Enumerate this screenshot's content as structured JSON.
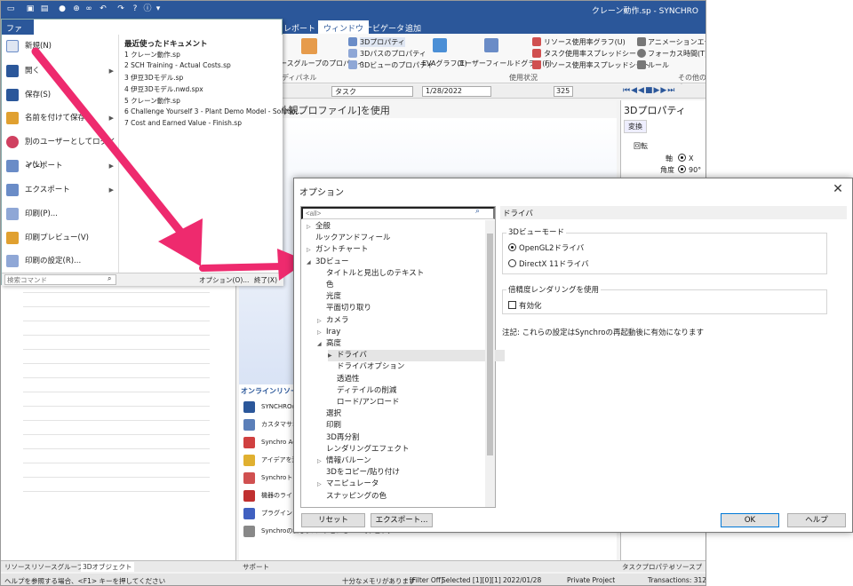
{
  "app": {
    "window_title": "クレーン動作.sp - SYNCHRO"
  },
  "menubar": {
    "file": "ファイル",
    "tabs": [
      "レポート",
      "ウィンドウ",
      "ナビゲータ",
      "追加"
    ]
  },
  "ribbon": {
    "resource_group_props": "ースグループのプロパティ",
    "items3d": [
      "3Dプロパティ",
      "3Dパスのプロパティ",
      "3Dビューのプロパティ"
    ],
    "evagraph": "EVAグラフ(E)",
    "user_field_graph": "ユーザーフィールドグラフ(F)",
    "usage": [
      "リソース使用率グラフ(U)",
      "タスク使用率スプレッドシート",
      "リソース使用率スプレッドシート"
    ],
    "misc": [
      "アニメーションエディタ",
      "フォーカス時間(T)",
      "ルール"
    ],
    "group_labels": [
      "ディパネル",
      "使用状況",
      "その他のウ"
    ]
  },
  "toolbar": {
    "task": "タスク",
    "date": "1/28/2022",
    "zoom": "325"
  },
  "file_menu": {
    "items": [
      {
        "label": "新規(N)",
        "arrow": false
      },
      {
        "label": "開く",
        "arrow": true
      },
      {
        "label": "保存(S)",
        "arrow": false
      },
      {
        "label": "名前を付けて保存",
        "arrow": true
      },
      {
        "label": "別のユーザーとしてログイン(L)",
        "arrow": false
      },
      {
        "label": "インポート",
        "arrow": true
      },
      {
        "label": "エクスポート",
        "arrow": true
      },
      {
        "label": "印刷(P)...",
        "arrow": false
      },
      {
        "label": "印刷プレビュー(V)",
        "arrow": false
      },
      {
        "label": "印刷の設定(R)...",
        "arrow": false
      }
    ],
    "recent_title": "最近使ったドキュメント",
    "recent": [
      "1 クレーン動作.sp",
      "2 SCH Training - Actual Costs.sp",
      "3 伊豆3Dモデル.sp",
      "4 伊豆3Dモデル.nwd.spx",
      "5 クレーン動作.sp",
      "6 Challenge Yourself 3 - Plant Demo Model - Solutio...",
      "7 Cost and Earned Value - Finish.sp"
    ],
    "search_placeholder": "検索コマンド",
    "options_button": "オプション(O)...",
    "exit_button": "終了(X)"
  },
  "view": {
    "header": "最高]色[外観プロファイル]を使用"
  },
  "right_panel": {
    "title": "3Dプロパティ",
    "tab": "変換",
    "rotation": "回転",
    "axis": "軸",
    "axis_x": "X",
    "angle": "角度",
    "angle_val": "90°"
  },
  "online": {
    "title": "オンラインリソース",
    "items": [
      "SYNCHROの",
      "カスタマサポ",
      "Synchro Ac",
      "アイデアを送",
      "Synchroトレ",
      "機器のライ",
      "プラグインと",
      "Synchroの新しいバージョンをWebでチェック"
    ]
  },
  "bottom_tabs": [
    "リソース",
    "リソースグループ",
    "3Dオブジェクト",
    "サポート",
    "タスクプロパティ",
    "リソースプロ"
  ],
  "status": {
    "help": "ヘルプを参照する場合、<F1> キーを押してください",
    "memory": "十分なメモリがあります",
    "filter": "[Filter Off]",
    "selected": "Selected [1][0][1]",
    "date": "2022/01/28",
    "project": "Private Project",
    "transactions": "Transactions: 3127"
  },
  "dialog": {
    "title": "オプション",
    "search": "<all>",
    "tree": [
      {
        "label": "全般",
        "level": 0,
        "exp": "▷"
      },
      {
        "label": "ルックアンドフィール",
        "level": 0,
        "exp": ""
      },
      {
        "label": "ガントチャート",
        "level": 0,
        "exp": "▷"
      },
      {
        "label": "3Dビュー",
        "level": 0,
        "exp": "◢"
      },
      {
        "label": "タイトルと見出しのテキスト",
        "level": 1,
        "exp": ""
      },
      {
        "label": "色",
        "level": 1,
        "exp": ""
      },
      {
        "label": "光度",
        "level": 1,
        "exp": ""
      },
      {
        "label": "平面切り取り",
        "level": 1,
        "exp": ""
      },
      {
        "label": "カメラ",
        "level": 1,
        "exp": "▷"
      },
      {
        "label": "Iray",
        "level": 1,
        "exp": "▷"
      },
      {
        "label": "高度",
        "level": 1,
        "exp": "◢"
      },
      {
        "label": "ドライバ",
        "level": 2,
        "exp": "▶",
        "sel": true
      },
      {
        "label": "ドライバオプション",
        "level": 2,
        "exp": ""
      },
      {
        "label": "透過性",
        "level": 2,
        "exp": ""
      },
      {
        "label": "ディテイルの削減",
        "level": 2,
        "exp": ""
      },
      {
        "label": "ロード/アンロード",
        "level": 2,
        "exp": ""
      },
      {
        "label": "選択",
        "level": 1,
        "exp": ""
      },
      {
        "label": "印刷",
        "level": 1,
        "exp": ""
      },
      {
        "label": "3D再分割",
        "level": 1,
        "exp": ""
      },
      {
        "label": "レンダリングエフェクト",
        "level": 1,
        "exp": ""
      },
      {
        "label": "情報バルーン",
        "level": 1,
        "exp": "▷"
      },
      {
        "label": "3Dをコピー/貼り付け",
        "level": 1,
        "exp": ""
      },
      {
        "label": "マニピュレータ",
        "level": 1,
        "exp": "▷"
      },
      {
        "label": "スナッピングの色",
        "level": 1,
        "exp": ""
      }
    ],
    "section_title": "ドライバ",
    "view_mode_label": "3Dビューモード",
    "radio_opengl": "OpenGL2ドライバ",
    "radio_directx": "DirectX 11ドライバ",
    "precision_label": "倍精度レンダリングを使用",
    "enable": "有効化",
    "note": "注記: これらの設定はSynchroの再起動後に有効になります",
    "reset": "リセット",
    "export": "エクスポート...",
    "ok": "OK",
    "help": "ヘルプ"
  },
  "colors": {
    "brand": "#2b579a",
    "arrow": "#ee2a6e"
  }
}
